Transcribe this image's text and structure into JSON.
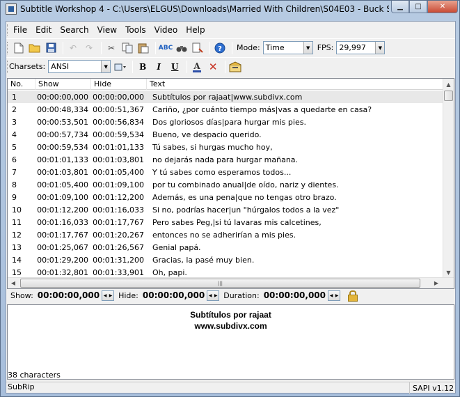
{
  "window": {
    "title": "Subtitle Workshop 4 - C:\\Users\\ELGUS\\Downloads\\Married With Children\\S04E03 - Buck Saves T..."
  },
  "menu": [
    "File",
    "Edit",
    "Search",
    "View",
    "Tools",
    "Video",
    "Help"
  ],
  "toolbar1": {
    "icons": [
      "new-file",
      "open-folder",
      "save",
      "undo",
      "redo",
      "cut",
      "copy",
      "paste",
      "spell-check",
      "find-binoculars",
      "replace",
      "help"
    ],
    "mode_label": "Mode:",
    "mode_value": "Time",
    "fps_label": "FPS:",
    "fps_value": "29,997"
  },
  "toolbar2": {
    "charsets_label": "Charsets:",
    "charsets_value": "ANSI",
    "format_buttons": [
      "B",
      "I",
      "U"
    ]
  },
  "grid": {
    "headers": [
      "No.",
      "Show",
      "Hide",
      "Text"
    ],
    "rows": [
      {
        "no": "1",
        "show": "00:00:00,000",
        "hide": "00:00:00,000",
        "text": "Subtítulos por rajaat|www.subdivx.com"
      },
      {
        "no": "2",
        "show": "00:00:48,334",
        "hide": "00:00:51,367",
        "text": "Cariño, ¿por cuánto tiempo más|vas a quedarte en casa?"
      },
      {
        "no": "3",
        "show": "00:00:53,501",
        "hide": "00:00:56,834",
        "text": "Dos gloriosos días|para hurgar mis pies."
      },
      {
        "no": "4",
        "show": "00:00:57,734",
        "hide": "00:00:59,534",
        "text": "Bueno, ve despacio querido."
      },
      {
        "no": "5",
        "show": "00:00:59,534",
        "hide": "00:01:01,133",
        "text": "Tú sabes, si hurgas mucho hoy,"
      },
      {
        "no": "6",
        "show": "00:01:01,133",
        "hide": "00:01:03,801",
        "text": "no dejarás nada para hurgar mañana."
      },
      {
        "no": "7",
        "show": "00:01:03,801",
        "hide": "00:01:05,400",
        "text": "Y tú sabes como esperamos todos..."
      },
      {
        "no": "8",
        "show": "00:01:05,400",
        "hide": "00:01:09,100",
        "text": "por tu combinado anual|de oído, nariz y dientes."
      },
      {
        "no": "9",
        "show": "00:01:09,100",
        "hide": "00:01:12,200",
        "text": "Además, es una pena|que no tengas otro brazo."
      },
      {
        "no": "10",
        "show": "00:01:12,200",
        "hide": "00:01:16,033",
        "text": "Si no, podrías hacer|un \"húrgalos todos a la vez\""
      },
      {
        "no": "11",
        "show": "00:01:16,033",
        "hide": "00:01:17,767",
        "text": "Pero sabes Peg,|si tú lavaras mis calcetines,"
      },
      {
        "no": "12",
        "show": "00:01:17,767",
        "hide": "00:01:20,267",
        "text": "entonces no se adherirían a mis pies."
      },
      {
        "no": "13",
        "show": "00:01:25,067",
        "hide": "00:01:26,567",
        "text": "Genial papá."
      },
      {
        "no": "14",
        "show": "00:01:29,200",
        "hide": "00:01:31,200",
        "text": "Gracias, la pasé muy bien."
      },
      {
        "no": "15",
        "show": "00:01:32,801",
        "hide": "00:01:33,901",
        "text": "Oh, papi."
      }
    ]
  },
  "timebar": {
    "show_label": "Show:",
    "show_value": "00:00:00,000",
    "hide_label": "Hide:",
    "hide_value": "00:00:00,000",
    "duration_label": "Duration:",
    "duration_value": "00:00:00,000"
  },
  "editor": {
    "line1": "Subtítulos por rajaat",
    "line2": "www.subdivx.com"
  },
  "charcount": "38 characters",
  "status": {
    "format": "SubRip",
    "engine": "SAPI v1.12"
  }
}
